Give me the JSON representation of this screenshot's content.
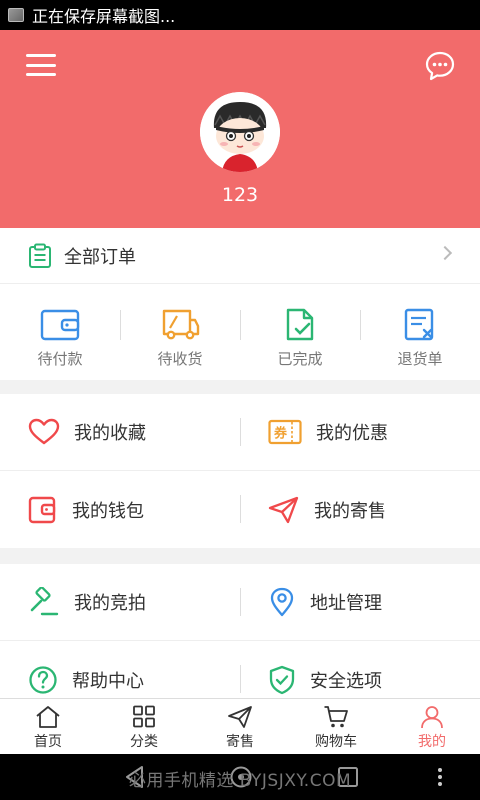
{
  "status_bar": {
    "text": "正在保存屏幕截图..."
  },
  "header": {
    "username": "123",
    "bg_color": "#f26b6b"
  },
  "orders": {
    "all_label": "全部订单",
    "statuses": [
      {
        "label": "待付款",
        "icon": "wallet-icon",
        "color": "#3a8ee6"
      },
      {
        "label": "待收货",
        "icon": "truck-icon",
        "color": "#f0a030"
      },
      {
        "label": "已完成",
        "icon": "document-check-icon",
        "color": "#2bb673"
      },
      {
        "label": "退货单",
        "icon": "document-cancel-icon",
        "color": "#3a8ee6"
      }
    ]
  },
  "menu": {
    "favorites": "我的收藏",
    "coupons": "我的优惠",
    "coupon_icon_text": "券",
    "wallet": "我的钱包",
    "consign": "我的寄售",
    "auction": "我的竞拍",
    "address": "地址管理",
    "help": "帮助中心",
    "security": "安全选项"
  },
  "tabs": [
    {
      "label": "首页",
      "icon": "home-icon"
    },
    {
      "label": "分类",
      "icon": "grid-icon"
    },
    {
      "label": "寄售",
      "icon": "send-icon"
    },
    {
      "label": "购物车",
      "icon": "cart-icon"
    },
    {
      "label": "我的",
      "icon": "user-icon",
      "active": true
    }
  ],
  "nav_bar": {
    "watermark": "必用手机精选 BYJSJXY.COM"
  },
  "colors": {
    "accent": "#f26b6b",
    "green": "#2bb673",
    "blue": "#3a8ee6",
    "orange": "#f0a030"
  }
}
